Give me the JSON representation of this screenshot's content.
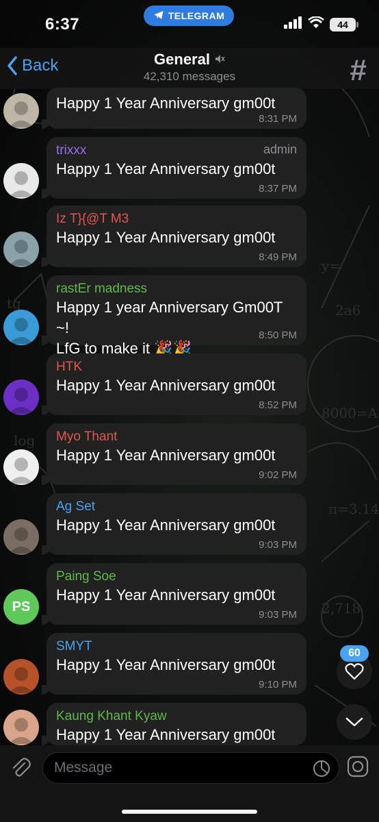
{
  "status_bar": {
    "time": "6:37",
    "app_pill": "TELEGRAM",
    "battery": "44"
  },
  "header": {
    "back_label": "Back",
    "title": "General",
    "subtitle": "42,310 messages"
  },
  "messages": [
    {
      "sender": "",
      "text": "Happy 1 Year Anniversary gm00t",
      "time": "8:31 PM",
      "sender_color": "#ffffff",
      "avatar_color": "#bfb6a8"
    },
    {
      "sender": "trixxx",
      "badge": "admin",
      "text": "Happy 1 Year Anniversary gm00t",
      "time": "8:37 PM",
      "sender_color": "#9b6cf0",
      "avatar_color": "#e9e9e9"
    },
    {
      "sender": "Iz T}{@T M3",
      "text": "Happy 1 Year Anniversary gm00t",
      "time": "8:49 PM",
      "sender_color": "#e0584f",
      "avatar_color": "#8aa2a8"
    },
    {
      "sender": "rastEr madness",
      "text": "Happy 1 year Anniversary Gm00T ~!",
      "text2": "LfG to make it 🎉🎉",
      "time": "8:50 PM",
      "sender_color": "#5fb84a",
      "avatar_color": "#3a9bd6"
    },
    {
      "sender": "HTK",
      "text": "Happy 1 Year Anniversary gm00t",
      "time": "8:52 PM",
      "sender_color": "#e0584f",
      "avatar_color": "#6b2fc4"
    },
    {
      "sender": "Myo Thant",
      "text": "Happy 1 Year Anniversary gm00t",
      "time": "9:02 PM",
      "sender_color": "#e0584f",
      "avatar_color": "#f0f0f0"
    },
    {
      "sender": "Ag Set",
      "text": "Happy 1 Year Anniversary gm00t",
      "time": "9:03 PM",
      "sender_color": "#4aa3f0",
      "avatar_color": "#7a6e62"
    },
    {
      "sender": "Paing Soe",
      "text": "Happy 1 Year Anniversary gm00t",
      "time": "9:03 PM",
      "sender_color": "#5fb84a",
      "avatar_color": "#5fc85a",
      "initials": "PS"
    },
    {
      "sender": "SMYT",
      "text": "Happy 1 Year Anniversary gm00t",
      "time": "9:10 PM",
      "sender_color": "#4aa3f0",
      "avatar_color": "#b5522a"
    },
    {
      "sender": "Kaung Khant Kyaw",
      "text": "Happy 1 Year Anniversary gm00t",
      "time": "",
      "sender_color": "#5fb84a",
      "avatar_color": "#d8a48a"
    }
  ],
  "reactions_badge": "60",
  "composer": {
    "placeholder": "Message"
  }
}
